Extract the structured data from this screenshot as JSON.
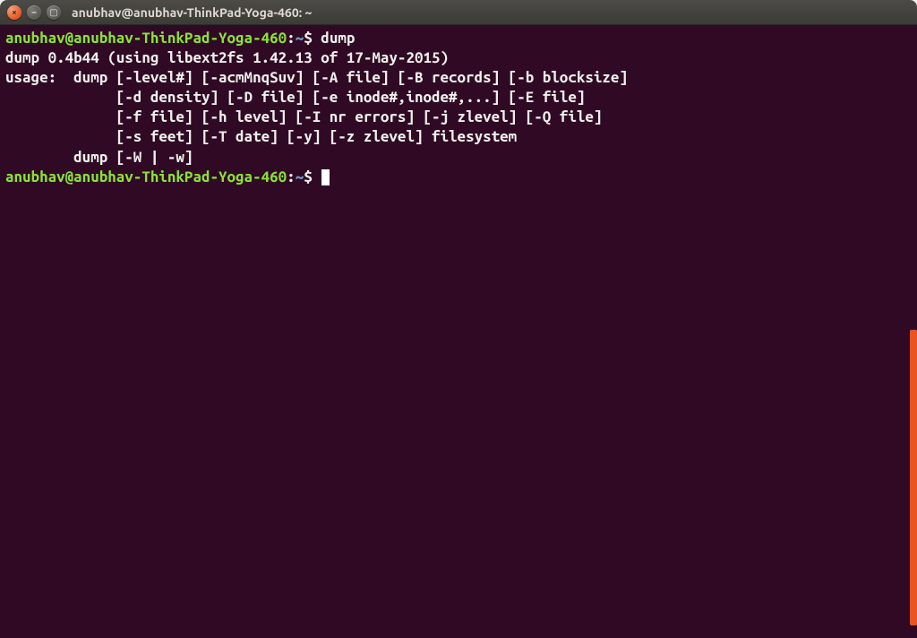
{
  "titlebar": {
    "title": "anubhav@anubhav-ThinkPad-Yoga-460: ~",
    "close_glyph": "×",
    "min_glyph": "–",
    "max_glyph": "▢"
  },
  "prompt": {
    "userhost": "anubhav@anubhav-ThinkPad-Yoga-460",
    "sep": ":",
    "path": "~",
    "sigil": "$"
  },
  "session": {
    "cmd1": "dump",
    "out1": "dump 0.4b44 (using libext2fs 1.42.13 of 17-May-2015)",
    "out2": "usage:  dump [-level#] [-acmMnqSuv] [-A file] [-B records] [-b blocksize]",
    "out3": "             [-d density] [-D file] [-e inode#,inode#,...] [-E file]",
    "out4": "             [-f file] [-h level] [-I nr errors] [-j zlevel] [-Q file]",
    "out5": "             [-s feet] [-T date] [-y] [-z zlevel] filesystem",
    "out6": "        dump [-W | -w]"
  },
  "colors": {
    "background": "#300a24",
    "foreground": "#eeeeec",
    "prompt_user": "#8ae234",
    "prompt_path": "#729fcf",
    "accent": "#e95420"
  }
}
